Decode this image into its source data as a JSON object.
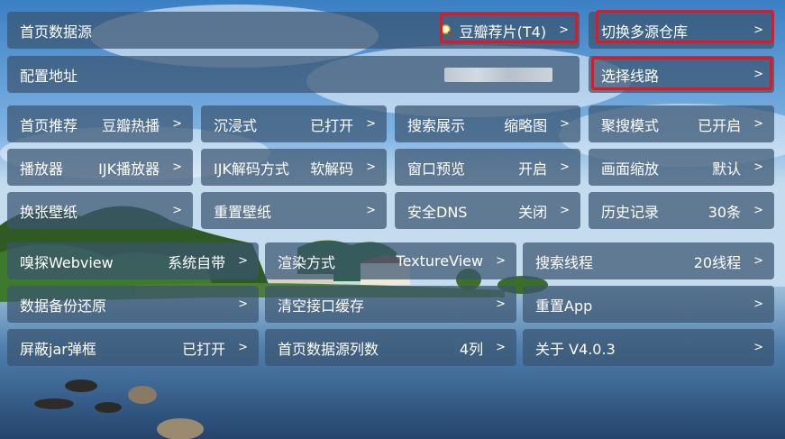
{
  "row0": {
    "home_source": {
      "label": "首页数据源",
      "value": "豆瓣荐片(T4)",
      "chevron": ">",
      "icon": "magnifier-icon"
    },
    "switch_repo": {
      "label": "切换多源仓库",
      "chevron": ">"
    }
  },
  "row1": {
    "config_addr": {
      "label": "配置地址",
      "value_blurred": true
    },
    "select_line": {
      "label": "选择线路",
      "chevron": ">"
    }
  },
  "grid": [
    {
      "label": "首页推荐",
      "value": "豆瓣热播",
      "chevron": ">"
    },
    {
      "label": "沉浸式",
      "value": "已打开",
      "chevron": ">"
    },
    {
      "label": "搜索展示",
      "value": "缩略图",
      "chevron": ">"
    },
    {
      "label": "聚搜模式",
      "value": "已开启",
      "chevron": ">"
    },
    {
      "label": "播放器",
      "value": "IJK播放器",
      "chevron": ">"
    },
    {
      "label": "IJK解码方式",
      "value": "软解码",
      "chevron": ">"
    },
    {
      "label": "窗口预览",
      "value": "开启",
      "chevron": ">"
    },
    {
      "label": "画面缩放",
      "value": "默认",
      "chevron": ">"
    },
    {
      "label": "换张壁纸",
      "value": "",
      "chevron": ">"
    },
    {
      "label": "重置壁纸",
      "value": "",
      "chevron": ">"
    },
    {
      "label": "安全DNS",
      "value": "关闭",
      "chevron": ">"
    },
    {
      "label": "历史记录",
      "value": "30条",
      "chevron": ">"
    }
  ],
  "grid3": [
    {
      "label": "嗅探Webview",
      "value": "系统自带",
      "chevron": ">"
    },
    {
      "label": "渲染方式",
      "value": "TextureView",
      "chevron": ">"
    },
    {
      "label": "搜索线程",
      "value": "20线程",
      "chevron": ">"
    },
    {
      "label": "数据备份还原",
      "value": "",
      "chevron": ">"
    },
    {
      "label": "清空接口缓存",
      "value": "",
      "chevron": ">"
    },
    {
      "label": "重置App",
      "value": "",
      "chevron": ">"
    },
    {
      "label": "屏蔽jar弹框",
      "value": "已打开",
      "chevron": ">"
    },
    {
      "label": "首页数据源列数",
      "value": "4列",
      "chevron": ">"
    },
    {
      "label": "关于  V4.0.3",
      "value": "",
      "chevron": ">"
    }
  ],
  "colors": {
    "tile_bg": "#3a5470",
    "highlight": "#e8141e",
    "text": "#ffffff"
  }
}
